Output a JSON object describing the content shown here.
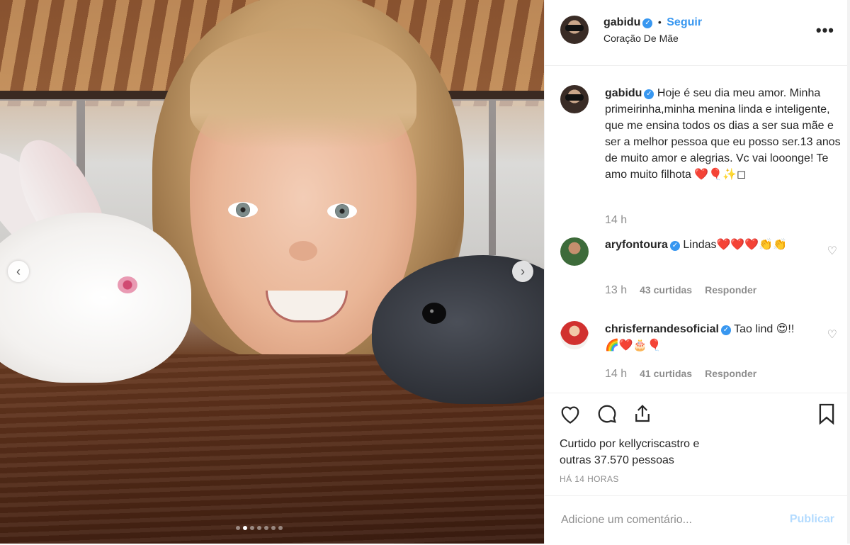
{
  "post": {
    "author": "gabidu",
    "follow_label": "Seguir",
    "separator": "•",
    "location": "Coração De Mãe",
    "more_label": "•••",
    "carousel": {
      "prev_icon": "‹",
      "next_icon": "›",
      "active_index": 2,
      "count": 7
    }
  },
  "caption": {
    "author": "gabidu",
    "text": "Hoje é seu dia meu amor. Minha primeirinha,minha menina linda e inteligente, que me ensina todos os dias a ser sua mãe e ser a melhor pessoa que eu posso ser.13 anos de muito amor e alegrias. Vc vai looonge! Te amo muito filhota ❤️🎈✨◻",
    "time": "14 h"
  },
  "comments": [
    {
      "author": "aryfontoura",
      "text": "Lindas❤️❤️❤️👏👏",
      "time": "13 h",
      "likes": "43 curtidas",
      "reply": "Responder"
    },
    {
      "author": "chrisfernandesoficial",
      "text": "Tao lind 😍!! 🌈❤️🎂🎈",
      "time": "14 h",
      "likes": "41 curtidas",
      "reply": "Responder"
    }
  ],
  "actions": {
    "liked_by": "Curtido por kellycriscastro e",
    "others": "outras 37.570 pessoas",
    "time_ago": "HÁ 14 HORAS",
    "comment_placeholder": "Adicione um comentário...",
    "publish_label": "Publicar"
  },
  "colors": {
    "link": "#3897f0",
    "muted": "#8e8e8e",
    "publish_disabled": "#b3dbff"
  }
}
